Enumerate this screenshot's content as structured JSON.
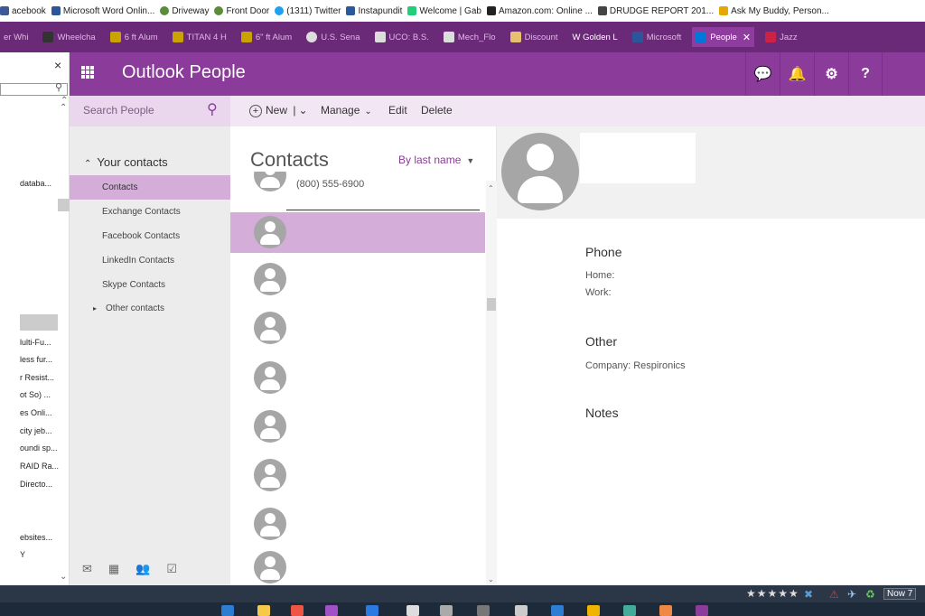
{
  "bookmarks": [
    {
      "label": "acebook",
      "color": "#3b5998"
    },
    {
      "label": "Microsoft Word Onlin...",
      "color": "#2b579a"
    },
    {
      "label": "Driveway",
      "color": "#5b8c3a"
    },
    {
      "label": "Front Door",
      "color": "#5b8c3a"
    },
    {
      "label": "(1311) Twitter",
      "color": "#1da1f2"
    },
    {
      "label": "Instapundit",
      "color": "#2a5a9a"
    },
    {
      "label": "Welcome | Gab",
      "color": "#21cf7a"
    },
    {
      "label": "Amazon.com: Online ...",
      "color": "#222222"
    },
    {
      "label": "DRUDGE REPORT 201...",
      "color": "#444444"
    },
    {
      "label": "Ask My Buddy, Person...",
      "color": "#e5a800"
    }
  ],
  "tabs": [
    {
      "label": "er Whi",
      "color": "#666"
    },
    {
      "label": "Wheelcha",
      "color": "#333"
    },
    {
      "label": "6 ft Alum",
      "color": "#c9a400"
    },
    {
      "label": "TITAN 4 H",
      "color": "#c9a400"
    },
    {
      "label": "6\" ft Alum",
      "color": "#c9a400"
    },
    {
      "label": "U.S. Sena",
      "color": "#ddd"
    },
    {
      "label": "UCO: B.S.",
      "color": "#ddd"
    },
    {
      "label": "Mech_Flo",
      "color": "#ddd"
    },
    {
      "label": "Discount",
      "color": "#e8c070"
    },
    {
      "label": "W Golden L",
      "color": "#fff"
    },
    {
      "label": "Microsoft",
      "color": "#2b579a"
    },
    {
      "label": "People",
      "color": "#0078d7"
    },
    {
      "label": "Jazz",
      "color": "#c24"
    }
  ],
  "active_tab_close": "✕",
  "sidebar": {
    "close": "×",
    "items": [
      "databa...",
      "lulti-Fu...",
      "less fur...",
      "r Resist...",
      "ot So) ...",
      "es Onli...",
      "city jeb...",
      "oundi sp...",
      "RAID Ra...",
      "Directo...",
      "ebsites...",
      "Y"
    ]
  },
  "header": {
    "title": "Outlook People",
    "buttons": [
      "💬",
      "🔔",
      "⚙",
      "?"
    ]
  },
  "toolbar": {
    "search_placeholder": "Search People",
    "new_label": "New",
    "manage_label": "Manage",
    "edit_label": "Edit",
    "delete_label": "Delete"
  },
  "nav": {
    "header": "Your contacts",
    "items": [
      "Contacts",
      "Exchange Contacts",
      "Facebook Contacts",
      "LinkedIn Contacts",
      "Skype Contacts",
      "Other contacts"
    ]
  },
  "list": {
    "title": "Contacts",
    "sort": "By last name",
    "partial_phone": "(800) 555-6900"
  },
  "detail": {
    "phone_section": "Phone",
    "home_label": "Home:",
    "work_label": "Work:",
    "other_section": "Other",
    "company_label": "Company:",
    "company_value": "Respironics",
    "notes_section": "Notes"
  },
  "taskbar": {
    "rating": "★★★★★",
    "now_label": "Now 7"
  }
}
